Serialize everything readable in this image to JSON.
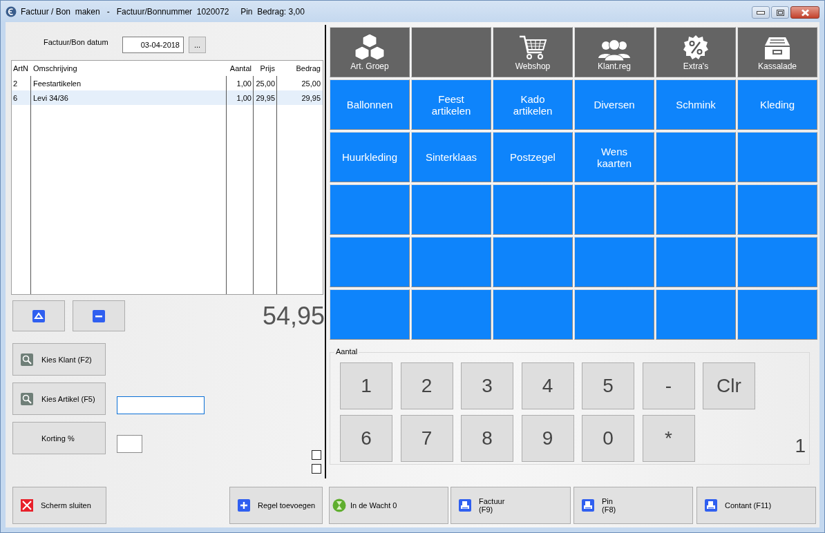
{
  "window": {
    "title": "Factuur / Bon  maken   -   Factuur/Bonnummer  1020072     Pin  Bedrag: 3,00"
  },
  "date": {
    "label": "Factuur/Bon datum",
    "value": "03-04-2018",
    "button": "..."
  },
  "table": {
    "columns": [
      "ArtN",
      "Omschrijving",
      "Aantal",
      "Prijs",
      "Bedrag"
    ],
    "rows": [
      {
        "cells": [
          "2",
          "Feestartikelen",
          "1,00",
          "25,00",
          "25,00"
        ],
        "selected": false
      },
      {
        "cells": [
          "6",
          "Levi 34/36",
          "1,00",
          "29,95",
          "29,95"
        ],
        "selected": true
      }
    ]
  },
  "total": "54,95",
  "side_buttons": [
    {
      "label": "Kies Klant (F2)",
      "kind": "search"
    },
    {
      "label": "Kies Artikel (F5)",
      "kind": "search"
    },
    {
      "label": "Korting %",
      "kind": "plain"
    }
  ],
  "checkboxes": [
    {
      "checked": false
    },
    {
      "checked": false
    }
  ],
  "function_tiles": [
    {
      "kind": "text",
      "label": "Art. Groep"
    },
    {
      "kind": "blank"
    },
    {
      "kind": "text",
      "label": "Webshop"
    },
    {
      "kind": "text",
      "label": "Klant.reg"
    },
    {
      "kind": "text",
      "label": "Extra's"
    },
    {
      "kind": "text",
      "label": "Kassalade"
    }
  ],
  "group_tiles": [
    {
      "kind": "text",
      "label": "Ballonnen"
    },
    {
      "kind": "text",
      "label": "Feest\nartikelen"
    },
    {
      "kind": "text",
      "label": "Kado\nartikelen"
    },
    {
      "kind": "text",
      "label": "Diversen"
    },
    {
      "kind": "text",
      "label": "Schmink"
    },
    {
      "kind": "text",
      "label": "Kleding"
    },
    {
      "kind": "text",
      "label": "Huurkleding"
    },
    {
      "kind": "text",
      "label": "Sinterklaas"
    },
    {
      "kind": "text",
      "label": "Postzegel"
    },
    {
      "kind": "text",
      "label": "Wens\nkaarten"
    },
    {
      "kind": "blank"
    },
    {
      "kind": "blank"
    },
    {
      "kind": "blank"
    },
    {
      "kind": "blank"
    },
    {
      "kind": "blank"
    },
    {
      "kind": "blank"
    },
    {
      "kind": "blank"
    },
    {
      "kind": "blank"
    },
    {
      "kind": "blank"
    },
    {
      "kind": "blank"
    },
    {
      "kind": "blank"
    },
    {
      "kind": "blank"
    },
    {
      "kind": "blank"
    },
    {
      "kind": "blank"
    },
    {
      "kind": "blank"
    },
    {
      "kind": "blank"
    },
    {
      "kind": "blank"
    },
    {
      "kind": "blank"
    },
    {
      "kind": "blank"
    },
    {
      "kind": "blank"
    }
  ],
  "numpad": {
    "legend": "Aantal",
    "keys": [
      "1",
      "2",
      "3",
      "4",
      "5",
      "-",
      "Clr",
      "6",
      "7",
      "8",
      "9",
      "0",
      "*"
    ],
    "display": "1"
  },
  "bottom_buttons": [
    {
      "label": "Scherm sluiten",
      "kind": "close"
    },
    {
      "label": "Regel toevoegen",
      "kind": "add"
    },
    {
      "label": "In de Wacht 0",
      "kind": "wait"
    },
    {
      "label": "Factuur\n(F9)",
      "kind": "print"
    },
    {
      "label": "Pin\n(F8)",
      "kind": "print"
    },
    {
      "label": "Contant (F11)",
      "kind": "print"
    }
  ]
}
